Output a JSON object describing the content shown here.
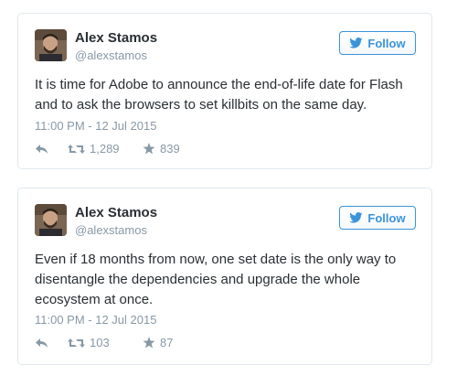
{
  "colors": {
    "accent": "#3b94d9",
    "muted": "#8899a6",
    "text": "#292f33",
    "border": "#e1e8ed"
  },
  "tweets": [
    {
      "author_name": "Alex Stamos",
      "author_handle": "@alexstamos",
      "follow_label": "Follow",
      "text": "It is time for Adobe to announce the end-of-life date for Flash\nand to ask the browsers to set killbits on the same day.",
      "timestamp": "11:00 PM - 12 Jul 2015",
      "retweets": "1,289",
      "likes": "839",
      "icons": [
        "reply-icon",
        "retweet-icon",
        "star-icon",
        "twitter-bird-icon"
      ]
    },
    {
      "author_name": "Alex Stamos",
      "author_handle": "@alexstamos",
      "follow_label": "Follow",
      "text": "Even if 18 months from now, one set date is the only way to\ndisentangle the dependencies and upgrade the whole\necosystem at once.",
      "timestamp": "11:00 PM - 12 Jul 2015",
      "retweets": "103",
      "likes": "87",
      "icons": [
        "reply-icon",
        "retweet-icon",
        "star-icon",
        "twitter-bird-icon"
      ]
    }
  ]
}
